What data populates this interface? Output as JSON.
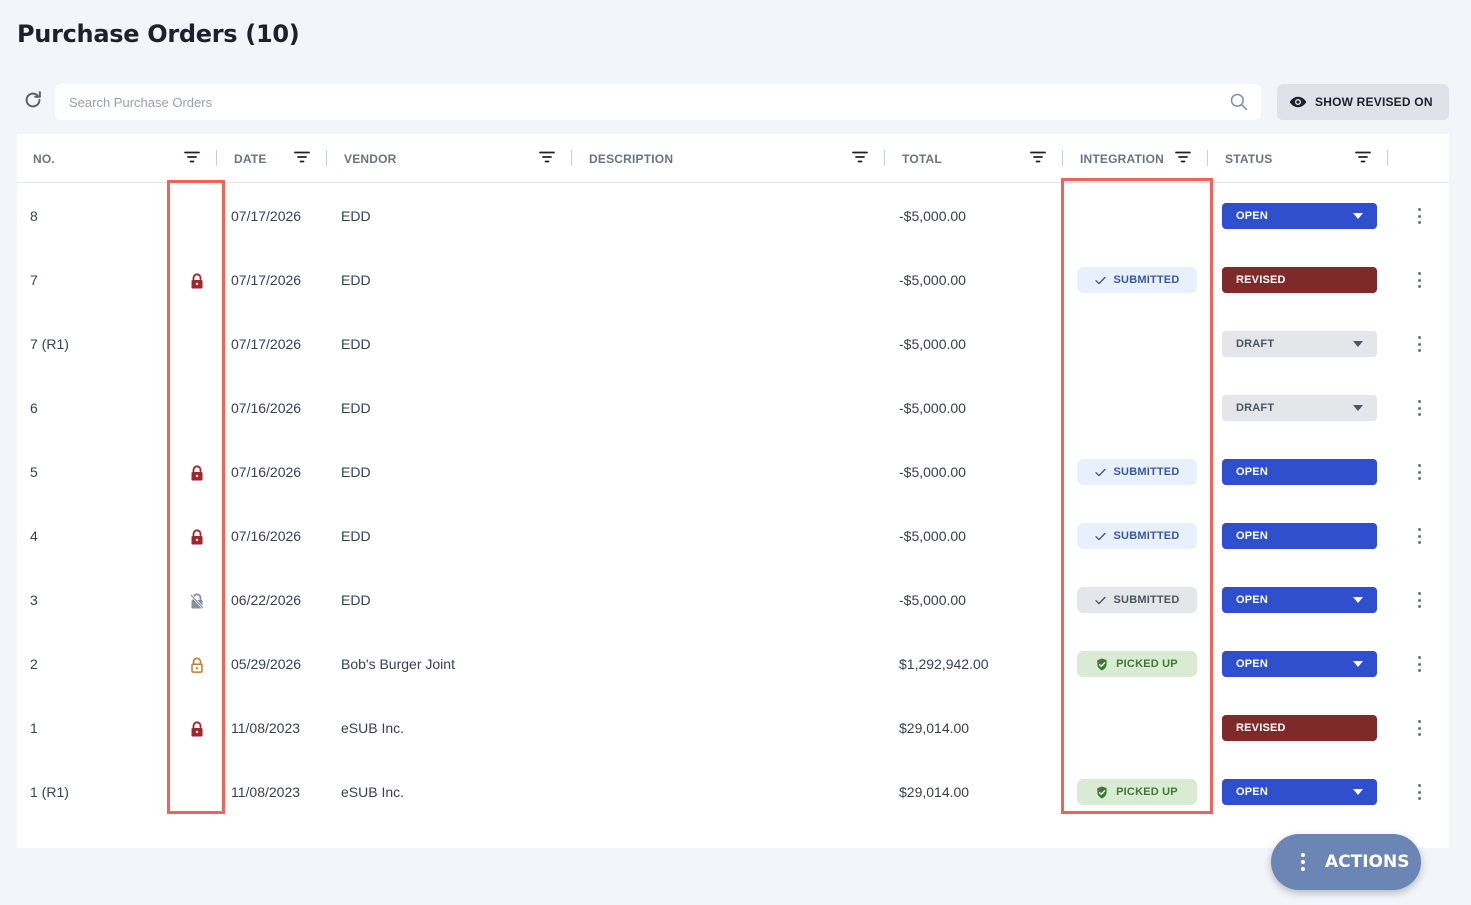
{
  "page": {
    "title": "Purchase Orders (10)"
  },
  "toolbar": {
    "search_placeholder": "Search Purchase Orders",
    "search_value": "",
    "show_revised_label": "SHOW REVISED ON"
  },
  "columns": {
    "no": "NO.",
    "date": "DATE",
    "vendor": "VENDOR",
    "description": "DESCRIPTION",
    "total": "TOTAL",
    "integration": "INTEGRATION",
    "status": "STATUS"
  },
  "rows": [
    {
      "no": "8",
      "lock": "none",
      "date": "07/17/2026",
      "vendor": "EDD",
      "description": "",
      "total": "-$5,000.00",
      "integration": "",
      "integration_style": "none",
      "status": "OPEN",
      "status_style": "open",
      "status_dropdown": true
    },
    {
      "no": "7",
      "lock": "locked",
      "date": "07/17/2026",
      "vendor": "EDD",
      "description": "",
      "total": "-$5,000.00",
      "integration": "SUBMITTED",
      "integration_style": "submitted",
      "status": "REVISED",
      "status_style": "revised",
      "status_dropdown": false
    },
    {
      "no": "7 (R1)",
      "lock": "none",
      "date": "07/17/2026",
      "vendor": "EDD",
      "description": "",
      "total": "-$5,000.00",
      "integration": "",
      "integration_style": "none",
      "status": "DRAFT",
      "status_style": "draft",
      "status_dropdown": true
    },
    {
      "no": "6",
      "lock": "none",
      "date": "07/16/2026",
      "vendor": "EDD",
      "description": "",
      "total": "-$5,000.00",
      "integration": "",
      "integration_style": "none",
      "status": "DRAFT",
      "status_style": "draft",
      "status_dropdown": true
    },
    {
      "no": "5",
      "lock": "locked",
      "date": "07/16/2026",
      "vendor": "EDD",
      "description": "",
      "total": "-$5,000.00",
      "integration": "SUBMITTED",
      "integration_style": "submitted",
      "status": "OPEN",
      "status_style": "open",
      "status_dropdown": false
    },
    {
      "no": "4",
      "lock": "locked",
      "date": "07/16/2026",
      "vendor": "EDD",
      "description": "",
      "total": "-$5,000.00",
      "integration": "SUBMITTED",
      "integration_style": "submitted",
      "status": "OPEN",
      "status_style": "open",
      "status_dropdown": false
    },
    {
      "no": "3",
      "lock": "lock-off",
      "date": "06/22/2026",
      "vendor": "EDD",
      "description": "",
      "total": "-$5,000.00",
      "integration": "SUBMITTED",
      "integration_style": "submitted-grey",
      "status": "OPEN",
      "status_style": "open",
      "status_dropdown": true
    },
    {
      "no": "2",
      "lock": "unlocked",
      "date": "05/29/2026",
      "vendor": "Bob's Burger Joint",
      "description": "",
      "total": "$1,292,942.00",
      "integration": "PICKED UP",
      "integration_style": "picked",
      "status": "OPEN",
      "status_style": "open",
      "status_dropdown": true
    },
    {
      "no": "1",
      "lock": "locked",
      "date": "11/08/2023",
      "vendor": "eSUB Inc.",
      "description": "",
      "total": "$29,014.00",
      "integration": "",
      "integration_style": "none",
      "status": "REVISED",
      "status_style": "revised",
      "status_dropdown": false
    },
    {
      "no": "1 (R1)",
      "lock": "none",
      "date": "11/08/2023",
      "vendor": "eSUB Inc.",
      "description": "",
      "total": "$29,014.00",
      "integration": "PICKED UP",
      "integration_style": "picked",
      "status": "OPEN",
      "status_style": "open",
      "status_dropdown": true
    }
  ],
  "fab": {
    "label": "ACTIONS"
  },
  "colors": {
    "open": "#2f4fcf",
    "revised": "#7e2a2a",
    "draft": "#e4e6e9",
    "lock_red": "#a3242a",
    "lock_orange": "#c9792a",
    "lock_grey": "#8a9099",
    "highlight": "#f0625a",
    "fab": "#6b86b5"
  },
  "icons": {
    "refresh": "refresh-icon",
    "search": "search-icon",
    "eye": "eye-icon",
    "filter": "filter-icon",
    "lock": "lock-icon",
    "kebab": "kebab-menu-icon"
  }
}
